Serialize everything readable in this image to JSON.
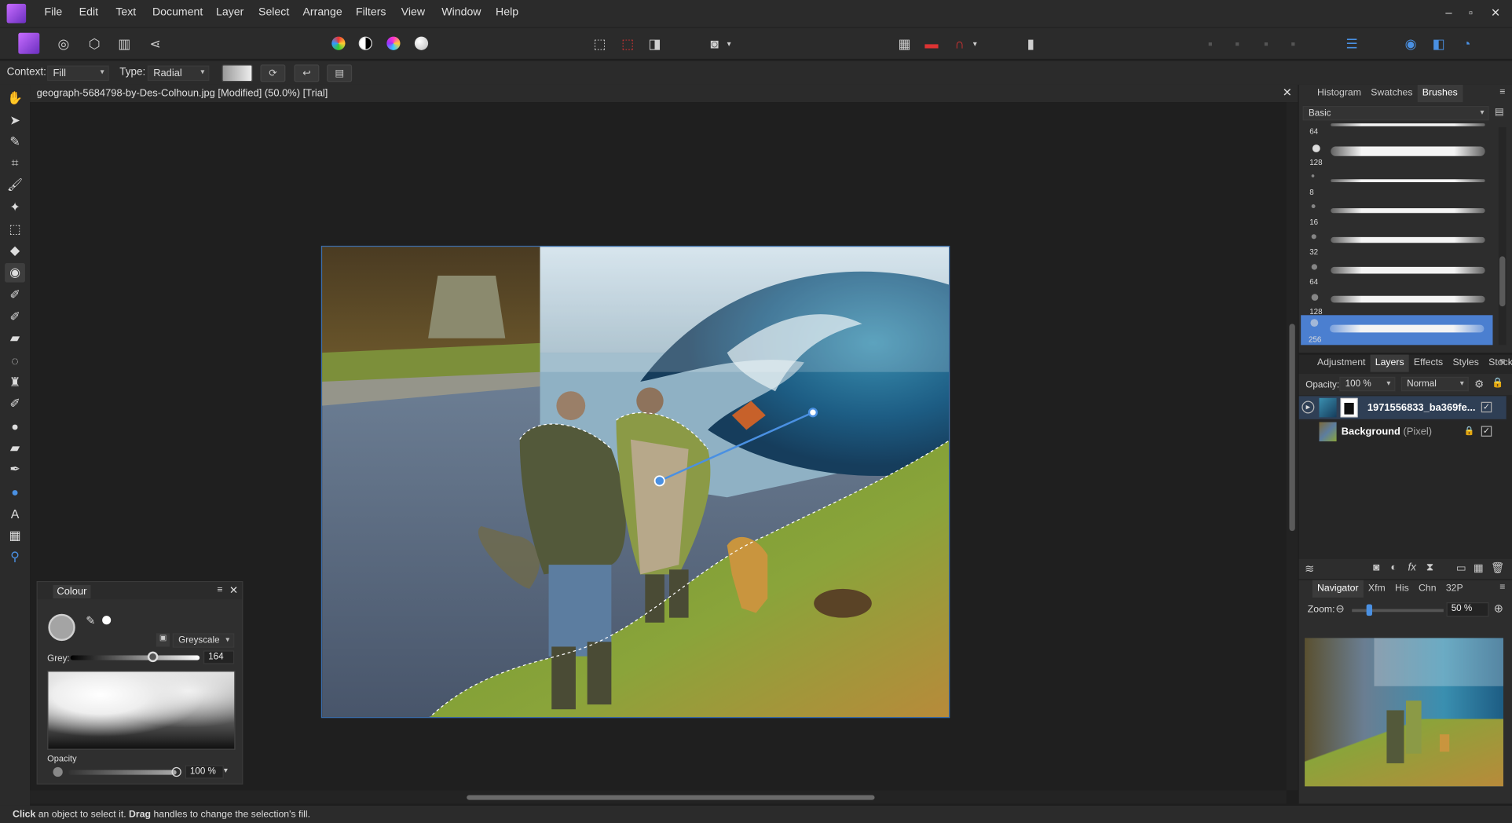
{
  "app": {
    "title": "Affinity Photo"
  },
  "menu": [
    "File",
    "Edit",
    "Text",
    "Document",
    "Layer",
    "Select",
    "Arrange",
    "Filters",
    "View",
    "Window",
    "Help"
  ],
  "window": {
    "minimize": "–",
    "maximize": "▫",
    "close": "✕"
  },
  "context": {
    "label": "Context:",
    "context_value": "Fill",
    "type_label": "Type:",
    "type_value": "Radial"
  },
  "document": {
    "tab_title": "geograph-5684798-by-Des-Colhoun.jpg [Modified] (50.0%) [Trial]",
    "close": "✕"
  },
  "status": {
    "b1": "Click",
    "t1": " an object to select it. ",
    "b2": "Drag",
    "t2": " handles to change the selection's fill."
  },
  "colour_panel": {
    "title": "Colour",
    "model": "Greyscale",
    "grey_label": "Grey:",
    "grey_value": "164",
    "opacity_label": "Opacity",
    "opacity_value": "100 %"
  },
  "brushes_panel": {
    "tabs": [
      "Histogram",
      "Swatches",
      "Brushes"
    ],
    "active_tab": "Brushes",
    "category": "Basic",
    "sizes": [
      "64",
      "128",
      "8",
      "16",
      "32",
      "64",
      "128",
      "256"
    ]
  },
  "layers_panel": {
    "tabs": [
      "Adjustment",
      "Layers",
      "Effects",
      "Styles",
      "Stock"
    ],
    "active_tab": "Layers",
    "opacity_label": "Opacity:",
    "opacity_value": "100 %",
    "blend_mode": "Normal",
    "layers": [
      {
        "name": "1971556833_ba369fe...",
        "kind": ""
      },
      {
        "name": "Background",
        "kind": " (Pixel)"
      }
    ]
  },
  "navigator_panel": {
    "tabs": [
      "Navigator",
      "Xfm",
      "His",
      "Chn",
      "32P"
    ],
    "active_tab": "Navigator",
    "zoom_label": "Zoom:",
    "zoom_value": "50 %"
  }
}
